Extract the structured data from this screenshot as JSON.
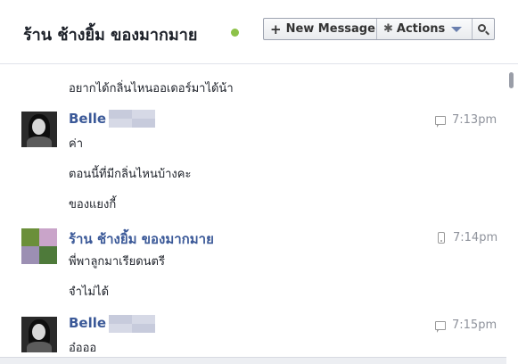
{
  "header": {
    "title": "ร้าน ช้างยิ้ม ของมากมาย",
    "online_color": "#8dc249",
    "toolbar": {
      "new_message_label": "New Message",
      "new_message_icon": "plus-icon",
      "actions_label": "Actions",
      "actions_icon": "gear-icon",
      "actions_dropdown_icon": "caret-down-icon",
      "search_icon": "search-icon"
    }
  },
  "thread": {
    "messages": [
      {
        "text": "อยากได้กลิ่นไหนออเดอร์มาได้น้า"
      },
      {
        "sender": "Belle",
        "time": "7:13pm",
        "source_icon": "chat-icon",
        "lines": [
          "ค่า",
          "ตอนนี้ที่มีกลิ่นไหนบ้างคะ",
          "ของแยงกี้"
        ]
      },
      {
        "sender": "ร้าน ช้างยิ้ม ของมากมาย",
        "time": "7:14pm",
        "source_icon": "mobile-icon",
        "lines": [
          "พี่พาลูกมาเรียดนตรี",
          "จำไม่ได้"
        ]
      },
      {
        "sender": "Belle",
        "time": "7:15pm",
        "source_icon": "chat-icon",
        "lines": [
          "อ๋อออ"
        ]
      }
    ]
  },
  "colors": {
    "sender_link": "#3b5998",
    "timestamp": "#8e929b",
    "body_text": "#1d2129"
  }
}
